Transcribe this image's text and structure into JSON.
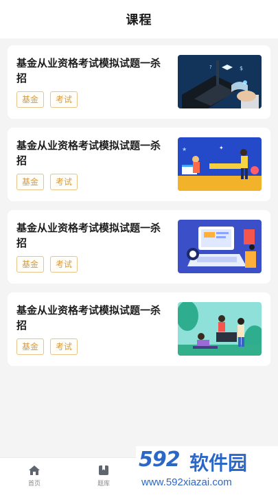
{
  "header": {
    "title": "课程"
  },
  "courses": [
    {
      "title": "基金从业资格考试模拟试题一杀招",
      "tags": [
        "基金",
        "考试"
      ],
      "image": "laptop-learning-illustration"
    },
    {
      "title": "基金从业资格考试模拟试题一杀招",
      "tags": [
        "基金",
        "考试"
      ],
      "image": "classroom-study-illustration"
    },
    {
      "title": "基金从业资格考试模拟试题一杀招",
      "tags": [
        "基金",
        "考试"
      ],
      "image": "computer-workspace-illustration"
    },
    {
      "title": "基金从业资格考试模拟试题一杀招",
      "tags": [
        "基金",
        "考试"
      ],
      "image": "students-reading-illustration"
    }
  ],
  "tabbar": {
    "items": [
      {
        "label": "首页",
        "icon": "home-icon"
      },
      {
        "label": "题库",
        "icon": "bookmark-book-icon"
      }
    ]
  },
  "watermark": {
    "logo": "592",
    "brand": "软件园",
    "url": "www.592xiazai.com"
  },
  "colors": {
    "tag_border": "#e7c48c",
    "tag_text": "#d79a3e",
    "page_bg": "#f4f4f4",
    "watermark": "#2b67c6"
  }
}
